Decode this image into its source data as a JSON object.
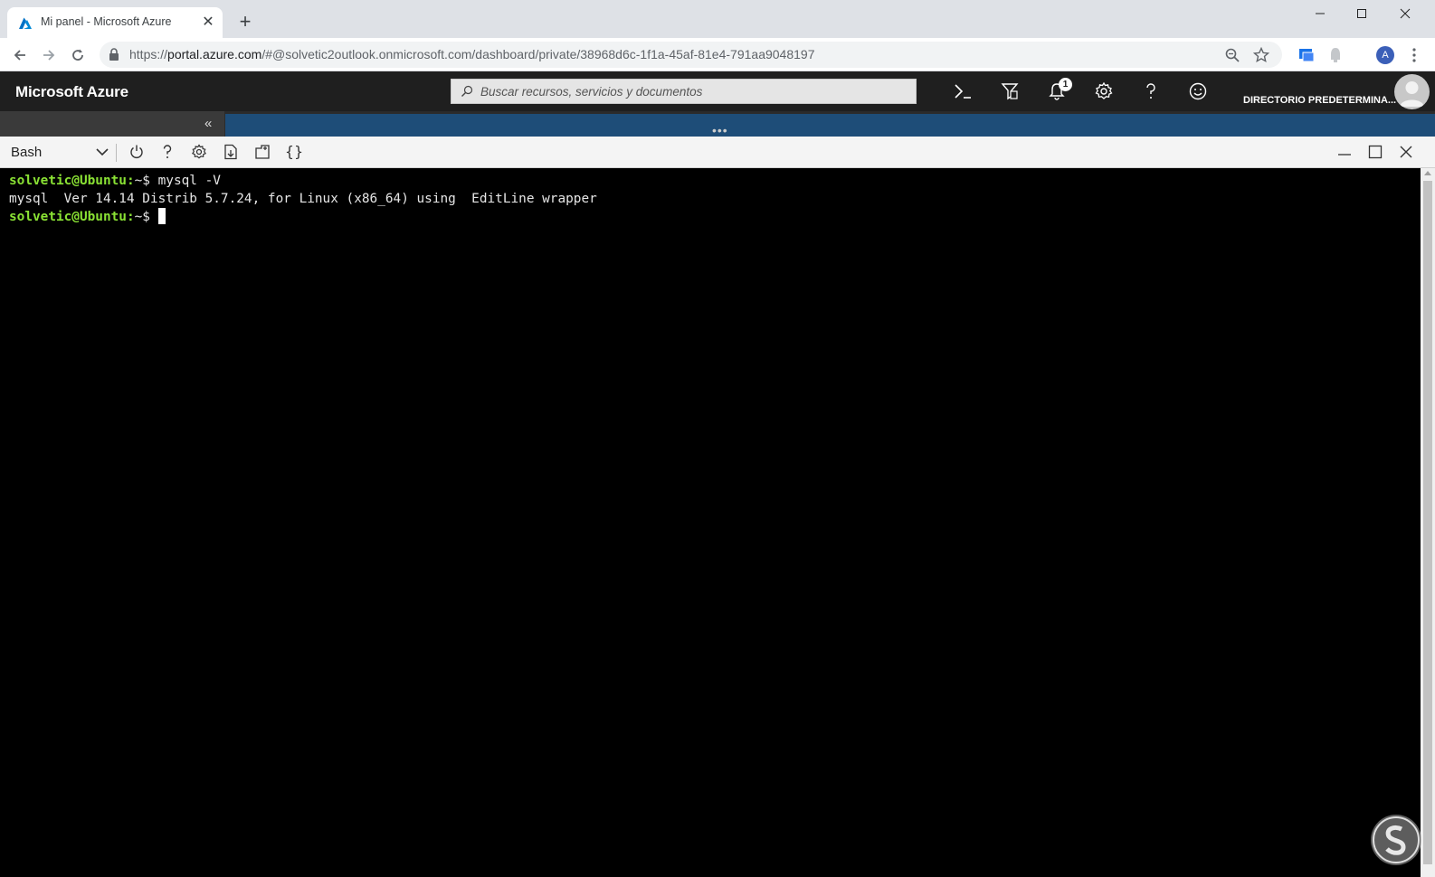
{
  "browser": {
    "tab_title": "Mi panel - Microsoft Azure",
    "tab_close": "✕",
    "new_tab": "+",
    "url_prefix": "https://",
    "url_host": "portal.azure.com",
    "url_rest": "/#@solvetic2outlook.onmicrosoft.com/dashboard/private/38968d6c-1f1a-45af-81e4-791aa9048197",
    "profile_initial": "A"
  },
  "azure": {
    "brand": "Microsoft Azure",
    "search_placeholder": "Buscar recursos, servicios y documentos",
    "notification_count": "1",
    "directory": "DIRECTORIO PREDETERMINA...",
    "collapse_glyph": "«",
    "resize_handle": "•••"
  },
  "shell": {
    "type": "Bash",
    "braces": "{}"
  },
  "terminal": {
    "lines": [
      {
        "prompt": "solvetic@Ubuntu:",
        "suffix": "~$ mysql -V"
      },
      {
        "output": "mysql  Ver 14.14 Distrib 5.7.24, for Linux (x86_64) using  EditLine wrapper"
      },
      {
        "prompt": "solvetic@Ubuntu:",
        "suffix": "~$ "
      }
    ]
  },
  "colors": {
    "prompt_green": "#8ae234",
    "azure_header": "#1f1f1f",
    "azure_blue": "#1e4d78"
  }
}
